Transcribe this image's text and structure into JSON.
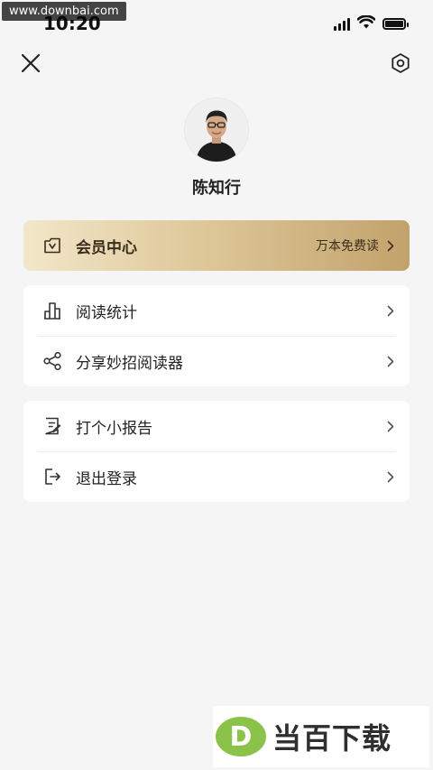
{
  "watermark_top": "www.downbai.com",
  "status_bar": {
    "time": "10:20"
  },
  "profile": {
    "name": "陈知行"
  },
  "member_card": {
    "label": "会员中心",
    "promo": "万本免费读"
  },
  "menu_group_1": [
    {
      "label": "阅读统计",
      "icon": "bar-chart-icon"
    },
    {
      "label": "分享妙招阅读器",
      "icon": "share-icon"
    }
  ],
  "menu_group_2": [
    {
      "label": "打个小报告",
      "icon": "report-icon"
    },
    {
      "label": "退出登录",
      "icon": "logout-icon"
    }
  ],
  "brand_watermark": {
    "letter": "D",
    "text": "当百下载"
  },
  "colors": {
    "background": "#f5f5f5",
    "member_gradient_start": "#f2e7c9",
    "member_gradient_end": "#c2a26c",
    "brand_green": "#8bc34a"
  }
}
